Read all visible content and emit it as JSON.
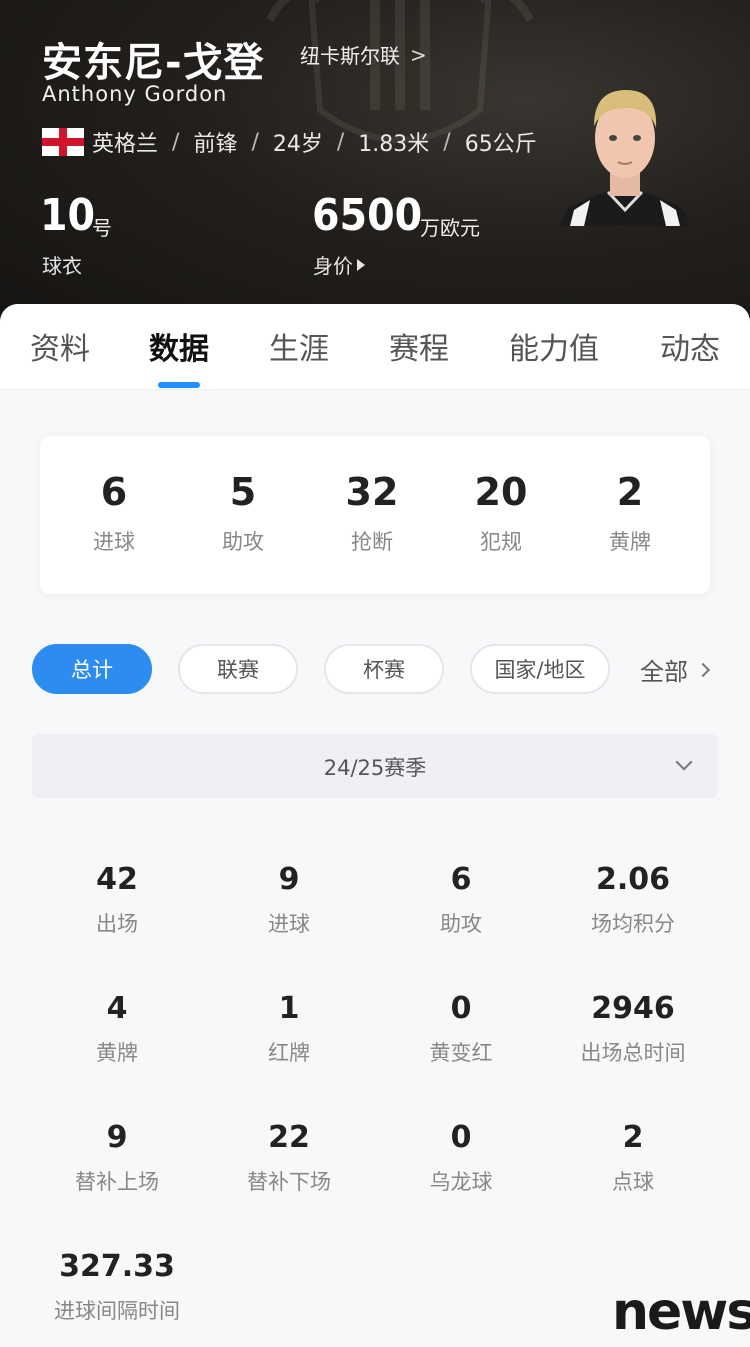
{
  "player": {
    "name_cn": "安东尼-戈登",
    "name_en": "Anthony  Gordon",
    "club": "纽卡斯尔联",
    "club_chevron": ">",
    "nation": "英格兰",
    "position": "前锋",
    "age": "24岁",
    "height": "1.83米",
    "weight": "65公斤",
    "separator": "/",
    "shirt_number": "10",
    "shirt_unit": "号",
    "shirt_label": "球衣",
    "market_value": "6500",
    "market_value_unit": "万欧元",
    "market_value_label": "身价"
  },
  "tabs": [
    "资料",
    "数据",
    "生涯",
    "赛程",
    "能力值",
    "动态"
  ],
  "active_tab": "数据",
  "summary": [
    {
      "value": "6",
      "label": "进球"
    },
    {
      "value": "5",
      "label": "助攻"
    },
    {
      "value": "32",
      "label": "抢断"
    },
    {
      "value": "20",
      "label": "犯规"
    },
    {
      "value": "2",
      "label": "黄牌"
    }
  ],
  "filters": [
    "总计",
    "联赛",
    "杯赛",
    "国家/地区"
  ],
  "active_filter": "总计",
  "all_label": "全部",
  "season": "24/25赛季",
  "stats": [
    {
      "value": "42",
      "label": "出场"
    },
    {
      "value": "9",
      "label": "进球"
    },
    {
      "value": "6",
      "label": "助攻"
    },
    {
      "value": "2.06",
      "label": "场均积分"
    },
    {
      "value": "4",
      "label": "黄牌"
    },
    {
      "value": "1",
      "label": "红牌"
    },
    {
      "value": "0",
      "label": "黄变红"
    },
    {
      "value": "2946",
      "label": "出场总时间"
    },
    {
      "value": "9",
      "label": "替补上场"
    },
    {
      "value": "22",
      "label": "替补下场"
    },
    {
      "value": "0",
      "label": "乌龙球"
    },
    {
      "value": "2",
      "label": "点球"
    },
    {
      "value": "327.33",
      "label": "进球间隔时间"
    }
  ],
  "watermark": "news",
  "colors": {
    "accent": "#2d8cf0",
    "tab_indicator": "#1e90ff",
    "header_bg": "#1f1c19",
    "flag_red": "#cf142b"
  },
  "icons": [
    "england-flag-icon",
    "chevron-right-icon",
    "triangle-right-icon",
    "chevron-down-icon"
  ]
}
